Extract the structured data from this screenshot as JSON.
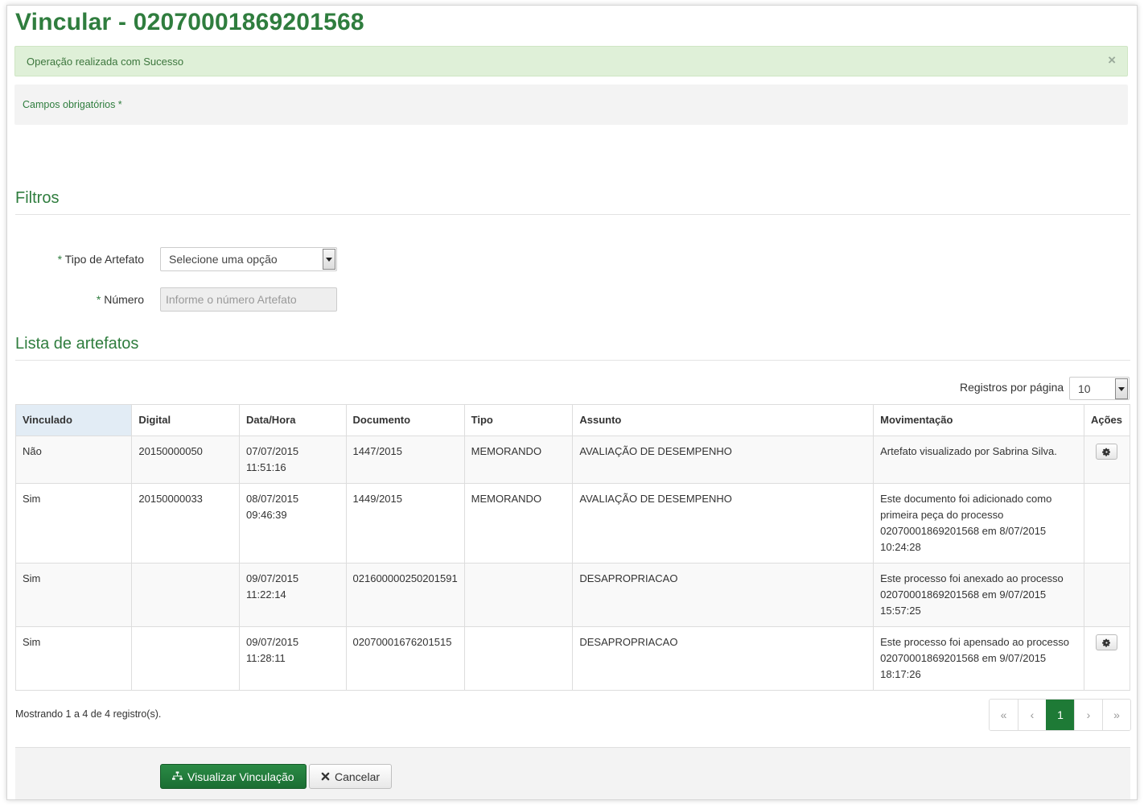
{
  "page": {
    "title": "Vincular - 02070001869201568",
    "success_message": "Operação realizada com Sucesso",
    "close_glyph": "×",
    "required_note": "Campos obrigatórios *"
  },
  "filters": {
    "title": "Filtros",
    "tipo_label": "Tipo de Artefato",
    "tipo_value": "Selecione uma opção",
    "numero_label": "Número",
    "numero_placeholder": "Informe o número Artefato",
    "required_star": "*"
  },
  "list": {
    "title": "Lista de artefatos",
    "per_page_label": "Registros por página",
    "per_page_value": "10",
    "columns": [
      "Vinculado",
      "Digital",
      "Data/Hora",
      "Documento",
      "Tipo",
      "Assunto",
      "Movimentação",
      "Ações"
    ],
    "rows": [
      {
        "vinculado": "Não",
        "digital": "20150000050",
        "data": "07/07/2015",
        "hora": "11:51:16",
        "documento": "1447/2015",
        "tipo": "MEMORANDO",
        "assunto": "AVALIAÇÃO DE DESEMPENHO",
        "movimentacao": [
          "Artefato visualizado por Sabrina Silva."
        ],
        "has_action": true
      },
      {
        "vinculado": "Sim",
        "digital": "20150000033",
        "data": "08/07/2015",
        "hora": "09:46:39",
        "documento": "1449/2015",
        "tipo": "MEMORANDO",
        "assunto": "AVALIAÇÃO DE DESEMPENHO",
        "movimentacao": [
          "Este documento foi adicionado como",
          "primeira peça do processo",
          "02070001869201568 em 8/07/2015",
          "10:24:28"
        ],
        "has_action": false
      },
      {
        "vinculado": "Sim",
        "digital": "",
        "data": "09/07/2015",
        "hora": "11:22:14",
        "documento": "021600000250201591",
        "tipo": "",
        "assunto": "DESAPROPRIACAO",
        "movimentacao": [
          "Este processo foi anexado ao processo",
          "02070001869201568 em 9/07/2015",
          "15:57:25"
        ],
        "has_action": false
      },
      {
        "vinculado": "Sim",
        "digital": "",
        "data": "09/07/2015",
        "hora": "11:28:11",
        "documento": "02070001676201515",
        "tipo": "",
        "assunto": "DESAPROPRIACAO",
        "movimentacao": [
          "Este processo foi apensado ao processo",
          "02070001869201568 em 9/07/2015",
          "18:17:26"
        ],
        "has_action": true
      }
    ],
    "footer_count": "Mostrando 1 a 4 de 4 registro(s).",
    "pagination": [
      "«",
      "‹",
      "1",
      "›",
      "»"
    ],
    "active_page": "1"
  },
  "actions": {
    "visualizar_label": "Visualizar Vinculação",
    "cancelar_label": "Cancelar",
    "visualizar_icon": "sitemap-icon",
    "cancelar_icon": "close-icon"
  },
  "colors": {
    "brand_green": "#2f7d3e",
    "success_bg": "#dff0d8",
    "active_page": "#1e7a36"
  }
}
